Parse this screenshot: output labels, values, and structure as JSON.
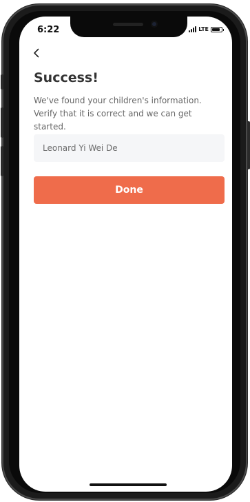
{
  "status_bar": {
    "time": "6:22",
    "network": "LTE",
    "icons": [
      "signal-icon",
      "battery-icon"
    ]
  },
  "nav": {
    "back_icon": "chevron-left-icon"
  },
  "content": {
    "title": "Success!",
    "subtitle": "We've found your children's information. Verify that it is correct and we can get started.",
    "child_name_value": "Leonard Yi Wei De",
    "done_label": "Done"
  },
  "colors": {
    "accent": "#EF6C4B",
    "field_background": "#F5F6F8",
    "title_text": "#333333",
    "body_text": "#666666"
  }
}
